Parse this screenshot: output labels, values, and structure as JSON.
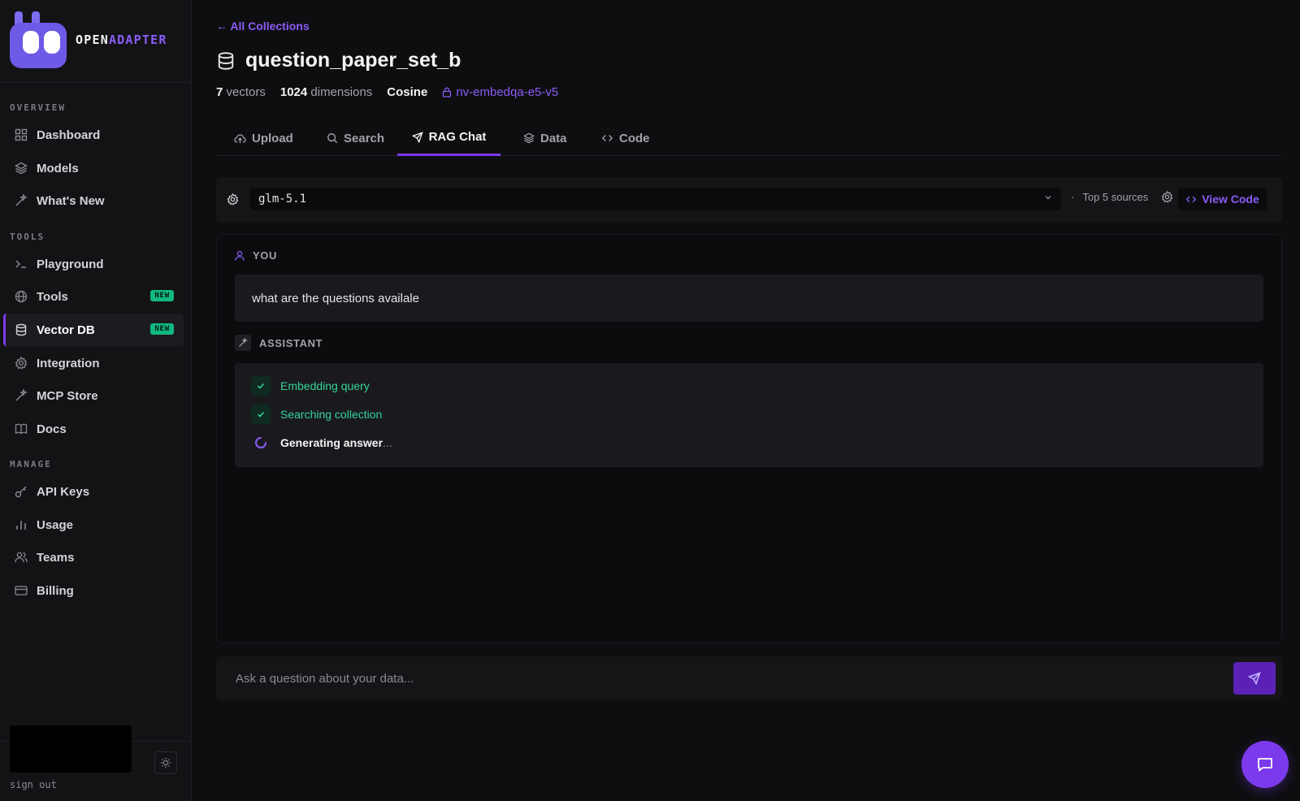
{
  "brand": {
    "part1": "OPEN",
    "part2": "ADAPTER"
  },
  "sidebar": {
    "sections": [
      "OVERVIEW",
      "TOOLS",
      "MANAGE"
    ],
    "overview": [
      {
        "label": "Dashboard",
        "icon": "grid-icon"
      },
      {
        "label": "Models",
        "icon": "layers-icon"
      },
      {
        "label": "What's New",
        "icon": "sparkle-icon"
      }
    ],
    "tools": [
      {
        "label": "Playground",
        "icon": "terminal-icon"
      },
      {
        "label": "Tools",
        "icon": "globe-icon",
        "badge": "NEW"
      },
      {
        "label": "Vector DB",
        "icon": "database-icon",
        "badge": "NEW",
        "active": true
      },
      {
        "label": "Integration",
        "icon": "gear-icon"
      },
      {
        "label": "MCP Store",
        "icon": "sparkle-icon"
      },
      {
        "label": "Docs",
        "icon": "book-icon"
      }
    ],
    "manage": [
      {
        "label": "API Keys",
        "icon": "key-icon"
      },
      {
        "label": "Usage",
        "icon": "bar-chart-icon"
      },
      {
        "label": "Teams",
        "icon": "users-icon"
      },
      {
        "label": "Billing",
        "icon": "card-icon"
      }
    ],
    "signout": "sign out"
  },
  "header": {
    "back": "← All Collections",
    "title": "question_paper_set_b",
    "vectors_count": "7",
    "vectors_label": "vectors",
    "dims_count": "1024",
    "dims_label": "dimensions",
    "metric": "Cosine",
    "model": "nv-embedqa-e5-v5"
  },
  "tabs": [
    {
      "label": "Upload",
      "icon": "upload-icon"
    },
    {
      "label": "Search",
      "icon": "search-icon"
    },
    {
      "label": "RAG Chat",
      "icon": "send-icon",
      "active": true
    },
    {
      "label": "Data",
      "icon": "layers-icon"
    },
    {
      "label": "Code",
      "icon": "code-icon"
    }
  ],
  "toolbar": {
    "model_value": "glm-5.1",
    "sep": "·",
    "top_sources": "Top 5 sources",
    "view_code": "View Code"
  },
  "chat": {
    "user_role": "YOU",
    "user_message": "what are the questions availale",
    "assistant_role": "ASSISTANT",
    "steps": [
      {
        "label": "Embedding query",
        "status": "done"
      },
      {
        "label": "Searching collection",
        "status": "done"
      },
      {
        "label": "Generating answer",
        "suffix": "...",
        "status": "loading"
      }
    ]
  },
  "ask": {
    "placeholder": "Ask a question about your data..."
  },
  "colors": {
    "accent": "#7c3aed",
    "accent_text": "#8b5cf6",
    "success": "#34d399",
    "badge": "#10b981"
  }
}
